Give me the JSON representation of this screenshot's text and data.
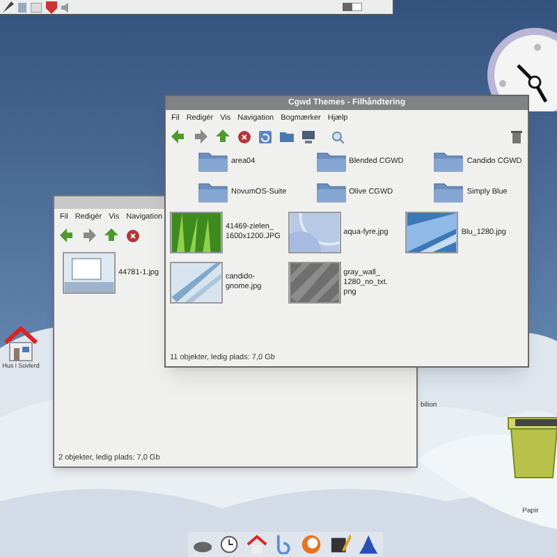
{
  "desktop": {
    "icons": [
      {
        "label": "Hus i Sovlerd",
        "kind": "home"
      },
      {
        "label": "bilion",
        "kind": "blob"
      },
      {
        "label": "Papir",
        "kind": "trash"
      }
    ]
  },
  "windows": [
    {
      "menu": [
        "Fil",
        "Redigér",
        "Vis",
        "Navigation"
      ],
      "files": [
        {
          "name": "44781-1.jpg"
        }
      ],
      "status": "2 objekter, ledig plads: 7,0 Gb"
    },
    {
      "title": "Cgwd Themes - Filhåndtering",
      "menu": [
        "Fil",
        "Redigér",
        "Vis",
        "Navigation",
        "Bogmærker",
        "Hjælp"
      ],
      "files": [
        {
          "name": "area04",
          "kind": "folder"
        },
        {
          "name": "Blended CGWD",
          "kind": "folder"
        },
        {
          "name": "Candido CGWD",
          "kind": "folder"
        },
        {
          "name": "NovumOS-Suite",
          "kind": "folder"
        },
        {
          "name": "Olive CGWD",
          "kind": "folder"
        },
        {
          "name": "Simply Blue",
          "kind": "folder"
        },
        {
          "name": "41469-zielen_ 1600x1200.JPG"
        },
        {
          "name": "aqua-fyre.jpg"
        },
        {
          "name": "Blu_1280.jpg"
        },
        {
          "name": "candido-gnome.jpg"
        },
        {
          "name": "gray_wall_ 1280_no_txt. png"
        }
      ],
      "status": "11 objekter, ledig plads: 7,0 Gb"
    }
  ]
}
